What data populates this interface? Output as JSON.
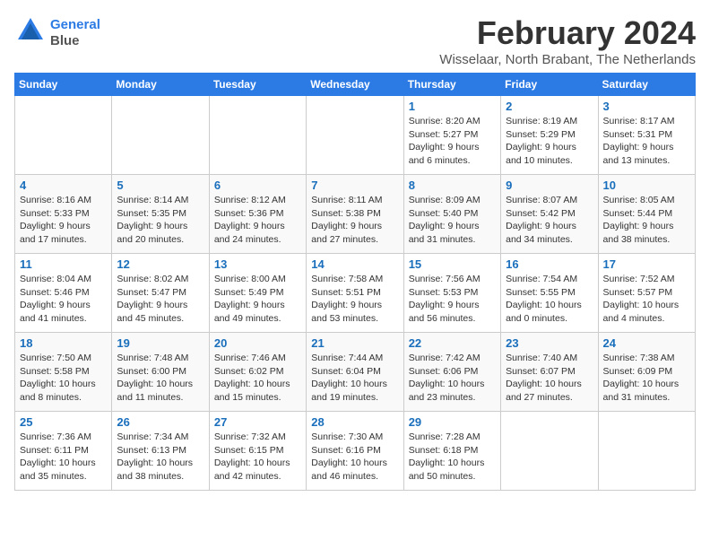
{
  "logo": {
    "line1": "General",
    "line2": "Blue"
  },
  "title": "February 2024",
  "location": "Wisselaar, North Brabant, The Netherlands",
  "days_header": [
    "Sunday",
    "Monday",
    "Tuesday",
    "Wednesday",
    "Thursday",
    "Friday",
    "Saturday"
  ],
  "weeks": [
    [
      {
        "day": "",
        "info": ""
      },
      {
        "day": "",
        "info": ""
      },
      {
        "day": "",
        "info": ""
      },
      {
        "day": "",
        "info": ""
      },
      {
        "day": "1",
        "info": "Sunrise: 8:20 AM\nSunset: 5:27 PM\nDaylight: 9 hours\nand 6 minutes."
      },
      {
        "day": "2",
        "info": "Sunrise: 8:19 AM\nSunset: 5:29 PM\nDaylight: 9 hours\nand 10 minutes."
      },
      {
        "day": "3",
        "info": "Sunrise: 8:17 AM\nSunset: 5:31 PM\nDaylight: 9 hours\nand 13 minutes."
      }
    ],
    [
      {
        "day": "4",
        "info": "Sunrise: 8:16 AM\nSunset: 5:33 PM\nDaylight: 9 hours\nand 17 minutes."
      },
      {
        "day": "5",
        "info": "Sunrise: 8:14 AM\nSunset: 5:35 PM\nDaylight: 9 hours\nand 20 minutes."
      },
      {
        "day": "6",
        "info": "Sunrise: 8:12 AM\nSunset: 5:36 PM\nDaylight: 9 hours\nand 24 minutes."
      },
      {
        "day": "7",
        "info": "Sunrise: 8:11 AM\nSunset: 5:38 PM\nDaylight: 9 hours\nand 27 minutes."
      },
      {
        "day": "8",
        "info": "Sunrise: 8:09 AM\nSunset: 5:40 PM\nDaylight: 9 hours\nand 31 minutes."
      },
      {
        "day": "9",
        "info": "Sunrise: 8:07 AM\nSunset: 5:42 PM\nDaylight: 9 hours\nand 34 minutes."
      },
      {
        "day": "10",
        "info": "Sunrise: 8:05 AM\nSunset: 5:44 PM\nDaylight: 9 hours\nand 38 minutes."
      }
    ],
    [
      {
        "day": "11",
        "info": "Sunrise: 8:04 AM\nSunset: 5:46 PM\nDaylight: 9 hours\nand 41 minutes."
      },
      {
        "day": "12",
        "info": "Sunrise: 8:02 AM\nSunset: 5:47 PM\nDaylight: 9 hours\nand 45 minutes."
      },
      {
        "day": "13",
        "info": "Sunrise: 8:00 AM\nSunset: 5:49 PM\nDaylight: 9 hours\nand 49 minutes."
      },
      {
        "day": "14",
        "info": "Sunrise: 7:58 AM\nSunset: 5:51 PM\nDaylight: 9 hours\nand 53 minutes."
      },
      {
        "day": "15",
        "info": "Sunrise: 7:56 AM\nSunset: 5:53 PM\nDaylight: 9 hours\nand 56 minutes."
      },
      {
        "day": "16",
        "info": "Sunrise: 7:54 AM\nSunset: 5:55 PM\nDaylight: 10 hours\nand 0 minutes."
      },
      {
        "day": "17",
        "info": "Sunrise: 7:52 AM\nSunset: 5:57 PM\nDaylight: 10 hours\nand 4 minutes."
      }
    ],
    [
      {
        "day": "18",
        "info": "Sunrise: 7:50 AM\nSunset: 5:58 PM\nDaylight: 10 hours\nand 8 minutes."
      },
      {
        "day": "19",
        "info": "Sunrise: 7:48 AM\nSunset: 6:00 PM\nDaylight: 10 hours\nand 11 minutes."
      },
      {
        "day": "20",
        "info": "Sunrise: 7:46 AM\nSunset: 6:02 PM\nDaylight: 10 hours\nand 15 minutes."
      },
      {
        "day": "21",
        "info": "Sunrise: 7:44 AM\nSunset: 6:04 PM\nDaylight: 10 hours\nand 19 minutes."
      },
      {
        "day": "22",
        "info": "Sunrise: 7:42 AM\nSunset: 6:06 PM\nDaylight: 10 hours\nand 23 minutes."
      },
      {
        "day": "23",
        "info": "Sunrise: 7:40 AM\nSunset: 6:07 PM\nDaylight: 10 hours\nand 27 minutes."
      },
      {
        "day": "24",
        "info": "Sunrise: 7:38 AM\nSunset: 6:09 PM\nDaylight: 10 hours\nand 31 minutes."
      }
    ],
    [
      {
        "day": "25",
        "info": "Sunrise: 7:36 AM\nSunset: 6:11 PM\nDaylight: 10 hours\nand 35 minutes."
      },
      {
        "day": "26",
        "info": "Sunrise: 7:34 AM\nSunset: 6:13 PM\nDaylight: 10 hours\nand 38 minutes."
      },
      {
        "day": "27",
        "info": "Sunrise: 7:32 AM\nSunset: 6:15 PM\nDaylight: 10 hours\nand 42 minutes."
      },
      {
        "day": "28",
        "info": "Sunrise: 7:30 AM\nSunset: 6:16 PM\nDaylight: 10 hours\nand 46 minutes."
      },
      {
        "day": "29",
        "info": "Sunrise: 7:28 AM\nSunset: 6:18 PM\nDaylight: 10 hours\nand 50 minutes."
      },
      {
        "day": "",
        "info": ""
      },
      {
        "day": "",
        "info": ""
      }
    ]
  ]
}
